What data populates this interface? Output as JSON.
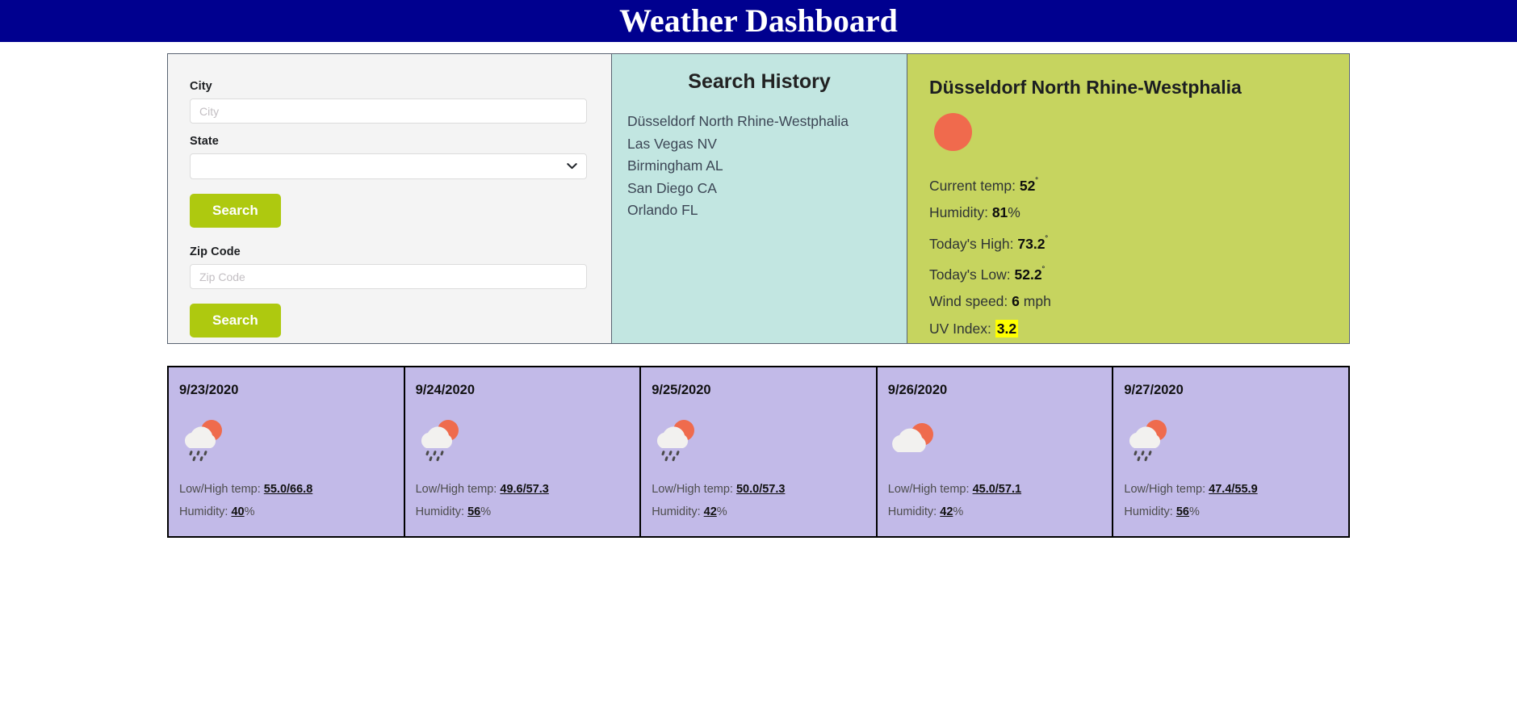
{
  "header": {
    "title": "Weather Dashboard",
    "bg_color": "#00008f",
    "text_color": "#ffffff"
  },
  "search_form": {
    "city_label": "City",
    "city_value": "",
    "city_placeholder": "City",
    "state_label": "State",
    "state_value": "",
    "state_options": [
      ""
    ],
    "city_search_label": "Search",
    "zip_label": "Zip Code",
    "zip_value": "",
    "zip_placeholder": "Zip Code",
    "zip_search_label": "Search",
    "button_color": "#aec90f",
    "panel_bg": "#f4f4f4"
  },
  "search_history": {
    "title": "Search History",
    "panel_bg": "#c2e6e1",
    "items": [
      {
        "label": "Düsseldorf North Rhine-Westphalia"
      },
      {
        "label": "Las Vegas NV"
      },
      {
        "label": "Birmingham AL"
      },
      {
        "label": "San Diego CA"
      },
      {
        "label": "Orlando FL"
      }
    ]
  },
  "current_weather": {
    "city": "Düsseldorf North Rhine-Westphalia",
    "panel_bg": "#c6d45f",
    "icon": "sun-circle-icon",
    "icon_color": "#f06a4d",
    "current_temp_label": "Current temp:",
    "current_temp_value": "52",
    "current_temp_unit": "˚",
    "humidity_label": "Humidity:",
    "humidity_value": "81",
    "humidity_unit": "%",
    "high_label": "Today's High:",
    "high_value": "73.2",
    "high_unit": "˚",
    "low_label": "Today's Low:",
    "low_value": "52.2",
    "low_unit": "˚",
    "wind_label": "Wind speed:",
    "wind_value": "6",
    "wind_unit": "mph",
    "uv_label": "UV Index:",
    "uv_value": "3.2",
    "uv_highlight_color": "#ffff00"
  },
  "forecast": {
    "panel_bg": "#c2bae8",
    "border_color": "#000000",
    "low_high_label": "Low/High temp:",
    "humidity_label": "Humidity:",
    "humidity_unit": "%",
    "cards": [
      {
        "date": "9/23/2020",
        "icon": "sun-cloud-rain-icon",
        "low_high": "55.0/66.8",
        "humidity": "40"
      },
      {
        "date": "9/24/2020",
        "icon": "sun-cloud-rain-icon",
        "low_high": "49.6/57.3",
        "humidity": "56"
      },
      {
        "date": "9/25/2020",
        "icon": "sun-cloud-rain-icon",
        "low_high": "50.0/57.3",
        "humidity": "42"
      },
      {
        "date": "9/26/2020",
        "icon": "sun-cloud-icon",
        "low_high": "45.0/57.1",
        "humidity": "42"
      },
      {
        "date": "9/27/2020",
        "icon": "sun-cloud-rain-icon",
        "low_high": "47.4/55.9",
        "humidity": "56"
      }
    ]
  }
}
